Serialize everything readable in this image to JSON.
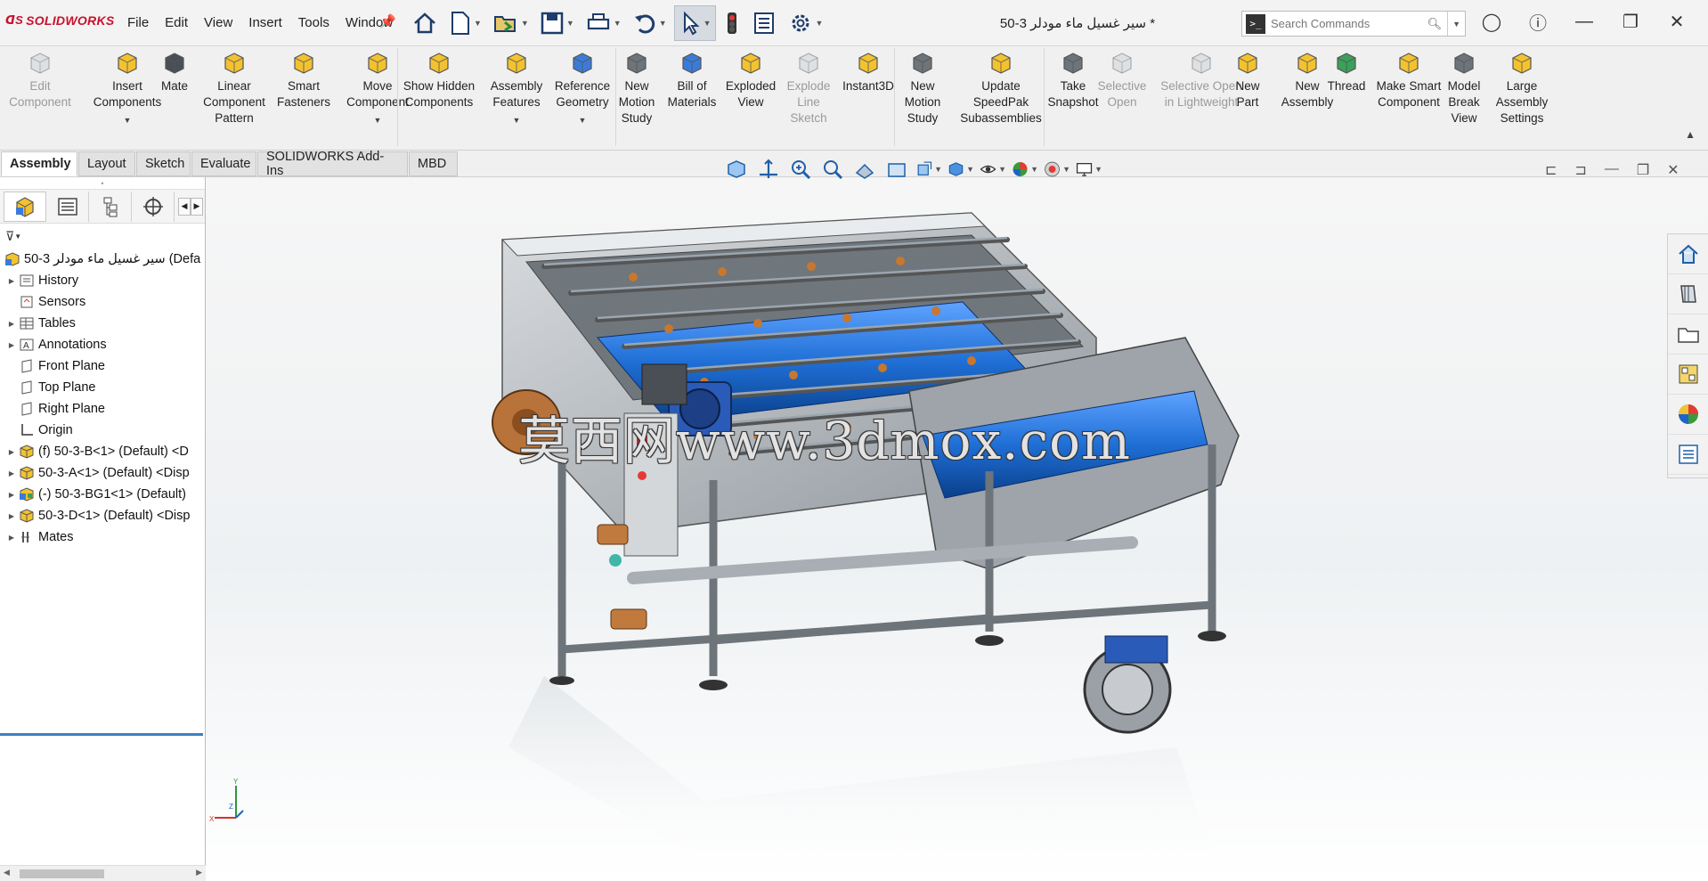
{
  "app": {
    "name": "SOLIDWORKS",
    "brand_color": "#c8102e"
  },
  "menu": [
    "File",
    "Edit",
    "View",
    "Insert",
    "Tools",
    "Window"
  ],
  "document_title": "سير غسيل ماء مودلر 3-50 *",
  "search": {
    "placeholder": "Search Commands"
  },
  "ribbon": [
    {
      "label": "Edit Component",
      "enabled": false,
      "icon": "edit-component-icon"
    },
    {
      "label": "Insert Components",
      "enabled": true,
      "icon": "insert-components-icon"
    },
    {
      "label": "Mate",
      "enabled": true,
      "icon": "mate-icon"
    },
    {
      "label": "Linear Component Pattern",
      "enabled": true,
      "icon": "linear-pattern-icon"
    },
    {
      "label": "Smart Fasteners",
      "enabled": true,
      "icon": "smart-fasteners-icon"
    },
    {
      "label": "Move Component",
      "enabled": true,
      "icon": "move-component-icon"
    },
    {
      "label": "Show Hidden Components",
      "enabled": true,
      "icon": "show-hidden-icon"
    },
    {
      "label": "Assembly Features",
      "enabled": true,
      "icon": "assembly-features-icon"
    },
    {
      "label": "Reference Geometry",
      "enabled": true,
      "icon": "reference-geometry-icon"
    },
    {
      "label": "New Motion Study",
      "enabled": true,
      "icon": "motion-study-icon"
    },
    {
      "label": "Bill of Materials",
      "enabled": true,
      "icon": "bom-icon"
    },
    {
      "label": "Exploded View",
      "enabled": true,
      "icon": "exploded-view-icon"
    },
    {
      "label": "Explode Line Sketch",
      "enabled": false,
      "icon": "explode-line-icon"
    },
    {
      "label": "Instant3D",
      "enabled": true,
      "icon": "instant3d-icon"
    },
    {
      "label": "New Motion Study",
      "enabled": true,
      "icon": "motion-study-icon"
    },
    {
      "label": "Update SpeedPak Subassemblies",
      "enabled": true,
      "icon": "speedpak-icon"
    },
    {
      "label": "Take Snapshot",
      "enabled": true,
      "icon": "camera-icon"
    },
    {
      "label": "Selective Open",
      "enabled": false,
      "icon": "selective-open-icon"
    },
    {
      "label": "Selective Open in Lightweight",
      "enabled": false,
      "icon": "selective-lightweight-icon"
    },
    {
      "label": "New Part",
      "enabled": true,
      "icon": "new-part-icon"
    },
    {
      "label": "New Assembly",
      "enabled": true,
      "icon": "new-assembly-icon"
    },
    {
      "label": "Thread",
      "enabled": true,
      "icon": "thread-icon"
    },
    {
      "label": "Make Smart Component",
      "enabled": true,
      "icon": "smart-component-icon"
    },
    {
      "label": "Model Break View",
      "enabled": true,
      "icon": "model-break-icon"
    },
    {
      "label": "Large Assembly Settings",
      "enabled": true,
      "icon": "large-assembly-icon"
    }
  ],
  "tabs": [
    "Assembly",
    "Layout",
    "Sketch",
    "Evaluate",
    "SOLIDWORKS Add-Ins",
    "MBD"
  ],
  "active_tab": "Assembly",
  "tree": [
    {
      "label": "50-3 سير غسيل ماء مودلر (Defa",
      "icon": "assembly-icon",
      "expand": false
    },
    {
      "label": "History",
      "icon": "history-icon",
      "expand": true
    },
    {
      "label": "Sensors",
      "icon": "sensors-icon",
      "expand": false
    },
    {
      "label": "Tables",
      "icon": "tables-icon",
      "expand": true
    },
    {
      "label": "Annotations",
      "icon": "annotations-icon",
      "expand": true
    },
    {
      "label": "Front Plane",
      "icon": "plane-icon",
      "expand": false
    },
    {
      "label": "Top Plane",
      "icon": "plane-icon",
      "expand": false
    },
    {
      "label": "Right Plane",
      "icon": "plane-icon",
      "expand": false
    },
    {
      "label": "Origin",
      "icon": "origin-icon",
      "expand": false
    },
    {
      "label": "(f) 50-3-B<1> (Default) <D",
      "icon": "part-icon",
      "expand": true
    },
    {
      "label": "50-3-A<1> (Default) <Disp",
      "icon": "part-icon",
      "expand": true
    },
    {
      "label": "(-) 50-3-BG1<1> (Default)",
      "icon": "subassembly-icon",
      "expand": true
    },
    {
      "label": "50-3-D<1> (Default) <Disp",
      "icon": "part-icon",
      "expand": true
    },
    {
      "label": "Mates",
      "icon": "mates-icon",
      "expand": true
    }
  ],
  "watermark": "莫西网www.3dmox.com",
  "triad_labels": {
    "x": "X",
    "y": "Y",
    "z": "Z"
  },
  "colors": {
    "ribbon_bg": "#f0f0f0",
    "model_blue": "#1f6fd6",
    "frame_gray": "#9aa0a6",
    "copper": "#b8733a"
  }
}
